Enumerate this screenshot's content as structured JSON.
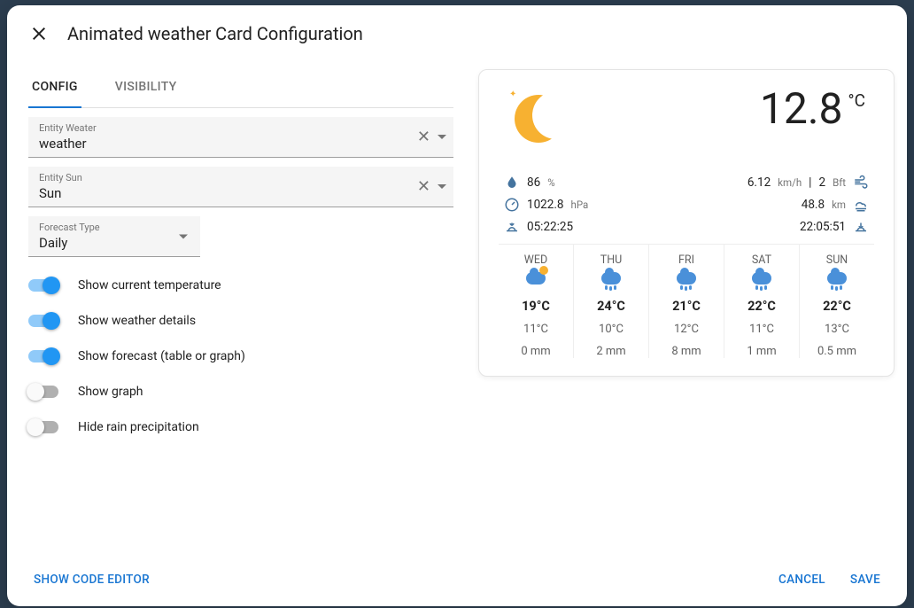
{
  "dialog": {
    "title": "Animated weather Card Configuration"
  },
  "tabs": {
    "config": "CONFIG",
    "visibility": "VISIBILITY"
  },
  "fields": {
    "entity_weather": {
      "label": "Entity Weater",
      "value": "weather"
    },
    "entity_sun": {
      "label": "Entity Sun",
      "value": "Sun"
    },
    "forecast_type": {
      "label": "Forecast Type",
      "value": "Daily"
    }
  },
  "toggles": {
    "show_temp": {
      "label": "Show current temperature",
      "on": true
    },
    "show_details": {
      "label": "Show weather details",
      "on": true
    },
    "show_forecast": {
      "label": "Show forecast (table or graph)",
      "on": true
    },
    "show_graph": {
      "label": "Show graph",
      "on": false
    },
    "hide_rain": {
      "label": "Hide rain precipitation",
      "on": false
    }
  },
  "footer": {
    "code_editor": "SHOW CODE EDITOR",
    "cancel": "CANCEL",
    "save": "SAVE"
  },
  "preview": {
    "temp": "12.8",
    "temp_unit": "°C",
    "humidity": "86",
    "humidity_unit": "%",
    "pressure": "1022.8",
    "pressure_unit": "hPa",
    "sunrise": "05:22:25",
    "wind": "6.12",
    "wind_unit": "km/h",
    "wind_bft": "2",
    "wind_bft_unit": "Bft",
    "visibility": "48.8",
    "visibility_unit": "km",
    "sunset": "22:05:51",
    "forecast": [
      {
        "day": "WED",
        "icon": "partly",
        "high": "19°C",
        "low": "11°C",
        "rain": "0 mm"
      },
      {
        "day": "THU",
        "icon": "rain",
        "high": "24°C",
        "low": "10°C",
        "rain": "2 mm"
      },
      {
        "day": "FRI",
        "icon": "rain",
        "high": "21°C",
        "low": "12°C",
        "rain": "8 mm"
      },
      {
        "day": "SAT",
        "icon": "rain",
        "high": "22°C",
        "low": "11°C",
        "rain": "1 mm"
      },
      {
        "day": "SUN",
        "icon": "rain",
        "high": "22°C",
        "low": "13°C",
        "rain": "0.5 mm"
      }
    ]
  }
}
